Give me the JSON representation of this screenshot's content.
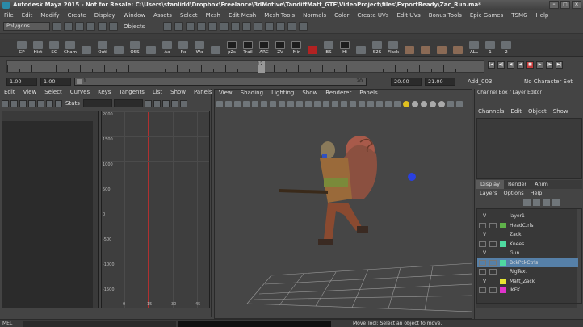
{
  "window": {
    "title": "Autodesk Maya 2015 - Not for Resale: C:\\Users\\stanlidd\\Dropbox\\Freelance\\3dMotive\\TandiffMatt_GTF\\VideoProject\\files\\ExportReady\\Zac_Run.ma*",
    "min_label": "–",
    "max_label": "□",
    "close_label": "×"
  },
  "menubar": [
    "File",
    "Edit",
    "Modify",
    "Create",
    "Display",
    "Window",
    "Assets",
    "Select",
    "Mesh",
    "Edit Mesh",
    "Mesh Tools",
    "Normals",
    "Color",
    "Create UVs",
    "Edit UVs",
    "Bonus Tools",
    "Epic Games",
    "TSMG",
    "Help"
  ],
  "statusline": {
    "mode": "Polygons",
    "objects_label": "Objects"
  },
  "shelf": {
    "buttons": [
      "CP",
      "Hist",
      "SC",
      "Cham",
      "",
      "Outl",
      "",
      "OSS",
      "",
      "Ax",
      "Fx",
      "Wx",
      "",
      "p2s",
      "Trail",
      "ARC",
      "ZV",
      "Mir",
      "",
      "BS",
      "Hi",
      "",
      "S2S",
      "Flask",
      "",
      "",
      "",
      "",
      "ALL",
      "1",
      "2"
    ]
  },
  "timeslider": {
    "current_frame": "12"
  },
  "range": {
    "start": "1.00",
    "playback_start": "1.00",
    "slider_start": "1",
    "slider_end": "20",
    "playback_end": "20.00",
    "end": "21.00",
    "anim_layer": "Add_003",
    "character_set": "No Character Set"
  },
  "graph_editor": {
    "menus": [
      "Edit",
      "View",
      "Select",
      "Curves",
      "Keys",
      "Tangents",
      "List",
      "Show",
      "Panels"
    ],
    "stats_label": "Stats",
    "y_ticks": [
      "2000",
      "1500",
      "1000",
      "500",
      "0",
      "-500",
      "-1000",
      "-1500"
    ],
    "x_ticks": [
      "0",
      "15",
      "30",
      "45"
    ]
  },
  "viewport": {
    "menus": [
      "View",
      "Shading",
      "Lighting",
      "Show",
      "Renderer",
      "Panels"
    ]
  },
  "channel_box": {
    "header": "Channel Box / Layer Editor",
    "menus": [
      "Channels",
      "Edit",
      "Object",
      "Show"
    ],
    "layer_tabs": [
      "Display",
      "Render",
      "Anim"
    ],
    "layer_menus": [
      "Layers",
      "Options",
      "Help"
    ],
    "layers": [
      {
        "vis": "V",
        "name": "layer1",
        "color": "",
        "selected": false
      },
      {
        "vis": "",
        "name": "HeadCtrls",
        "color": "#5fb24a",
        "selected": false
      },
      {
        "vis": "V",
        "name": "Zack",
        "color": "",
        "selected": false
      },
      {
        "vis": "",
        "name": "Knees",
        "color": "#4fd9a0",
        "selected": false
      },
      {
        "vis": "V",
        "name": "Gun",
        "color": "",
        "selected": false
      },
      {
        "vis": "",
        "name": "BckPckCtrls",
        "color": "#4fd9a0",
        "selected": true
      },
      {
        "vis": "",
        "name": "RigText",
        "color": "",
        "selected": false
      },
      {
        "vis": "V",
        "name": "Matt_Zack",
        "color": "#e6e633",
        "selected": false
      },
      {
        "vis": "",
        "name": "IKFK",
        "color": "#e033cc",
        "selected": false
      }
    ]
  },
  "statusbar": {
    "mel": "MEL",
    "help": "Move Tool: Select an object to move."
  }
}
